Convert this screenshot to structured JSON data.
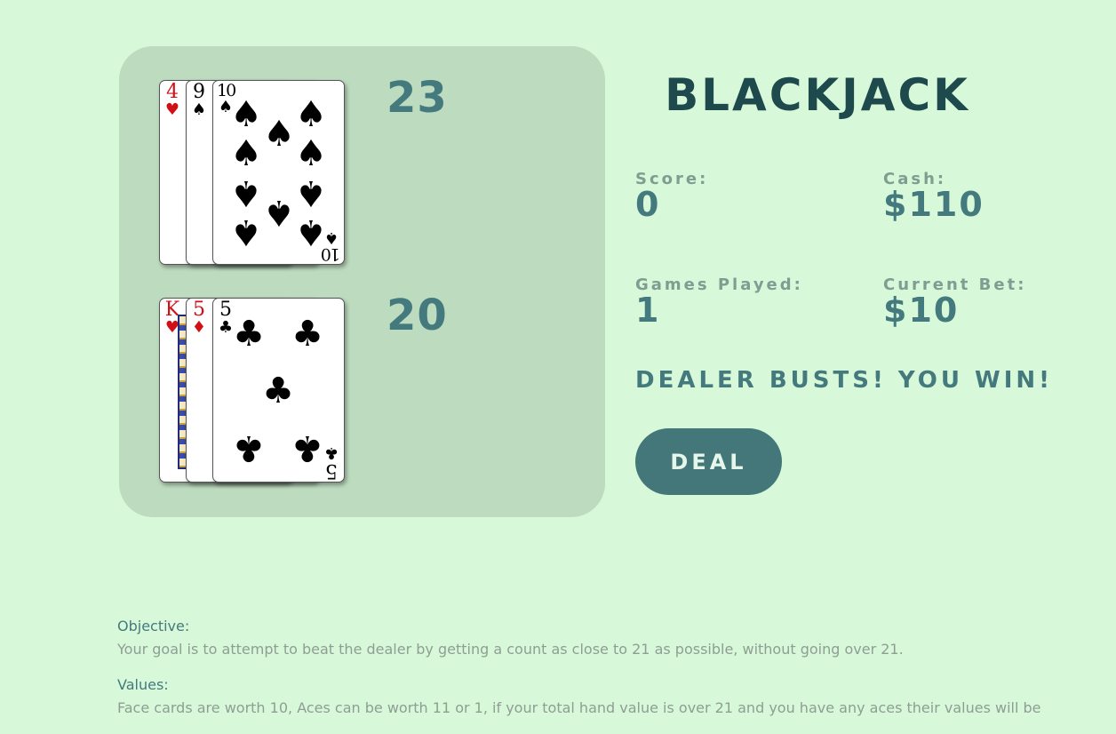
{
  "game": {
    "title": "BLACKJACK",
    "message": "DEALER BUSTS! YOU WIN!",
    "deal_label": "DEAL"
  },
  "stats": {
    "score_label": "Score:",
    "score_value": "0",
    "cash_label": "Cash:",
    "cash_value": "$110",
    "games_played_label": "Games Played:",
    "games_played_value": "1",
    "current_bet_label": "Current Bet:",
    "current_bet_value": "$10"
  },
  "dealer_hand": {
    "total": "23",
    "cards": [
      {
        "rank": "4",
        "suit": "heart",
        "suit_glyph": "♥"
      },
      {
        "rank": "9",
        "suit": "spade",
        "suit_glyph": "♠"
      },
      {
        "rank": "10",
        "suit": "spade",
        "suit_glyph": "♠"
      }
    ]
  },
  "player_hand": {
    "total": "20",
    "cards": [
      {
        "rank": "K",
        "suit": "heart",
        "suit_glyph": "♥"
      },
      {
        "rank": "5",
        "suit": "diamond",
        "suit_glyph": "♦"
      },
      {
        "rank": "5",
        "suit": "club",
        "suit_glyph": "♣"
      }
    ]
  },
  "rules": {
    "objective_heading": "Objective:",
    "objective_text": "Your goal is to attempt to beat the dealer by getting a count as close to 21 as possible, without going over 21.",
    "values_heading": "Values:",
    "values_text": "Face cards are worth 10, Aces can be worth 11 or 1, if your total hand value is over 21 and you have any aces their values will be"
  },
  "colors": {
    "background": "#d8f8da",
    "table": "#bddbbf",
    "accent": "#447a7d",
    "title": "#1f4a4d",
    "label": "#7f9d90"
  }
}
